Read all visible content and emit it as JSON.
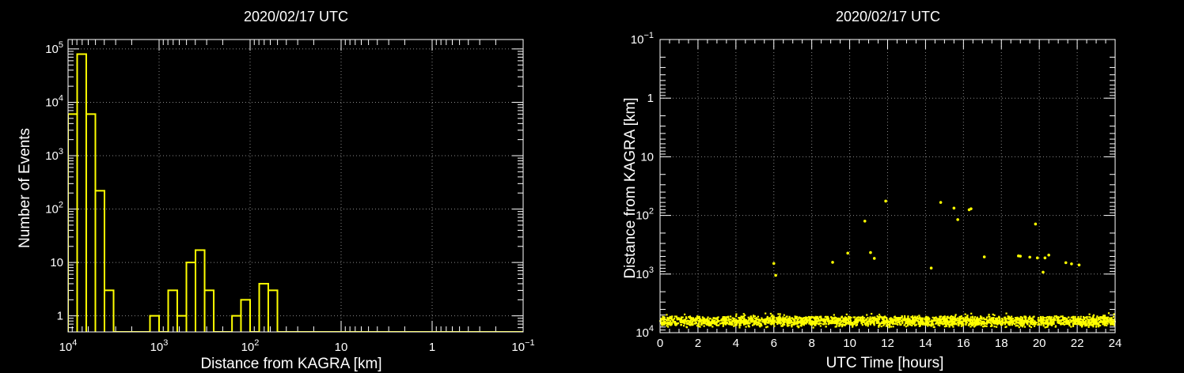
{
  "chart_data": [
    {
      "type": "histogram",
      "title": "2020/02/17 UTC",
      "xlabel": "Distance from KAGRA [km]",
      "ylabel": "Number of Events",
      "x_scale": "log",
      "x_reversed": true,
      "y_scale": "log",
      "xlim": [
        10000,
        0.1
      ],
      "ylim": [
        0.5,
        150000
      ],
      "grid": true,
      "line_color": "#ffff00",
      "x_ticks": [
        {
          "value": 10000,
          "base": "10",
          "exp": "4"
        },
        {
          "value": 1000,
          "base": "10",
          "exp": "3"
        },
        {
          "value": 100,
          "base": "10",
          "exp": "2"
        },
        {
          "value": 10,
          "base": "10",
          "exp": ""
        },
        {
          "value": 1,
          "base": "1",
          "exp": ""
        },
        {
          "value": 0.1,
          "base": "10",
          "exp": "−1"
        }
      ],
      "y_ticks": [
        {
          "value": 1,
          "base": "1",
          "exp": ""
        },
        {
          "value": 10,
          "base": "10",
          "exp": ""
        },
        {
          "value": 100,
          "base": "10",
          "exp": "2"
        },
        {
          "value": 1000,
          "base": "10",
          "exp": "3"
        },
        {
          "value": 10000,
          "base": "10",
          "exp": "4"
        },
        {
          "value": 100000,
          "base": "10",
          "exp": "5"
        }
      ],
      "bins": [
        {
          "x_from": 10000,
          "x_to": 7943,
          "count": 6000
        },
        {
          "x_from": 7943,
          "x_to": 6310,
          "count": 80000
        },
        {
          "x_from": 6310,
          "x_to": 5012,
          "count": 6000
        },
        {
          "x_from": 5012,
          "x_to": 3981,
          "count": 220
        },
        {
          "x_from": 3981,
          "x_to": 3162,
          "count": 3
        },
        {
          "x_from": 1259,
          "x_to": 1000,
          "count": 1
        },
        {
          "x_from": 794,
          "x_to": 631,
          "count": 3
        },
        {
          "x_from": 631,
          "x_to": 501,
          "count": 1
        },
        {
          "x_from": 501,
          "x_to": 398,
          "count": 10
        },
        {
          "x_from": 398,
          "x_to": 316,
          "count": 17
        },
        {
          "x_from": 316,
          "x_to": 251,
          "count": 3
        },
        {
          "x_from": 158,
          "x_to": 126,
          "count": 1
        },
        {
          "x_from": 126,
          "x_to": 100,
          "count": 2
        },
        {
          "x_from": 79.4,
          "x_to": 63.1,
          "count": 4
        },
        {
          "x_from": 63.1,
          "x_to": 50.1,
          "count": 3
        }
      ]
    },
    {
      "type": "scatter",
      "title": "2020/02/17 UTC",
      "xlabel": "UTC Time [hours]",
      "ylabel": "Distance from KAGRA [km]",
      "x_scale": "linear",
      "y_scale": "log",
      "y_reversed": true,
      "xlim": [
        0,
        24
      ],
      "ylim": [
        0.1,
        10000
      ],
      "grid": true,
      "marker_color": "#ffff00",
      "x_ticks": [
        0,
        2,
        4,
        6,
        8,
        10,
        12,
        14,
        16,
        18,
        20,
        22,
        24
      ],
      "y_ticks": [
        {
          "value": 0.1,
          "base": "10",
          "exp": "−1"
        },
        {
          "value": 1,
          "base": "1",
          "exp": ""
        },
        {
          "value": 10,
          "base": "10",
          "exp": ""
        },
        {
          "value": 100,
          "base": "10",
          "exp": "2"
        },
        {
          "value": 1000,
          "base": "10",
          "exp": "3"
        },
        {
          "value": 10000,
          "base": "10",
          "exp": "4"
        }
      ],
      "dense_band": {
        "x_range": [
          0,
          24
        ],
        "y_range": [
          5200,
          8200
        ]
      },
      "points": [
        {
          "x": 6.0,
          "y": 660
        },
        {
          "x": 6.1,
          "y": 1050
        },
        {
          "x": 9.1,
          "y": 630
        },
        {
          "x": 9.9,
          "y": 440
        },
        {
          "x": 10.8,
          "y": 125
        },
        {
          "x": 11.1,
          "y": 430
        },
        {
          "x": 11.3,
          "y": 540
        },
        {
          "x": 11.9,
          "y": 57
        },
        {
          "x": 14.3,
          "y": 790
        },
        {
          "x": 14.8,
          "y": 60
        },
        {
          "x": 15.5,
          "y": 75
        },
        {
          "x": 15.7,
          "y": 118
        },
        {
          "x": 16.3,
          "y": 80
        },
        {
          "x": 16.4,
          "y": 77
        },
        {
          "x": 17.1,
          "y": 510
        },
        {
          "x": 18.9,
          "y": 490
        },
        {
          "x": 19.0,
          "y": 495
        },
        {
          "x": 19.5,
          "y": 515
        },
        {
          "x": 19.8,
          "y": 140
        },
        {
          "x": 19.9,
          "y": 530
        },
        {
          "x": 20.2,
          "y": 930
        },
        {
          "x": 20.3,
          "y": 530
        },
        {
          "x": 20.5,
          "y": 475
        },
        {
          "x": 21.4,
          "y": 640
        },
        {
          "x": 21.7,
          "y": 670
        },
        {
          "x": 22.1,
          "y": 700
        }
      ]
    }
  ]
}
